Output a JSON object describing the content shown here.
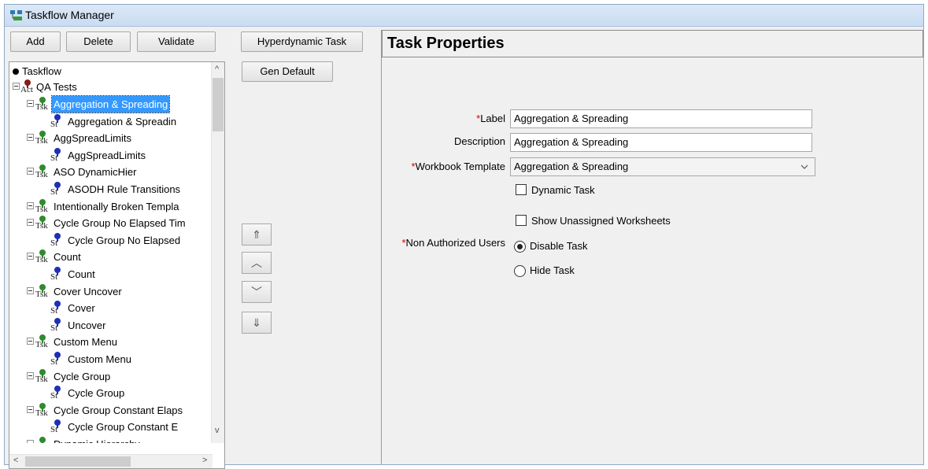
{
  "window": {
    "title": "Taskflow Manager"
  },
  "toolbar": {
    "add_label": "Add",
    "delete_label": "Delete",
    "validate_label": "Validate",
    "hyperdynamic_label": "Hyperdynamic Task",
    "gen_default_label": "Gen Default"
  },
  "tree": {
    "root": "Taskflow",
    "activity": "QA Tests",
    "items": [
      {
        "label": "Aggregation & Spreading",
        "icon": "Tsk"
      },
      {
        "label": "Aggregation & Spreadin",
        "icon": "St"
      },
      {
        "label": "AggSpreadLimits",
        "icon": "Tsk"
      },
      {
        "label": "AggSpreadLimits",
        "icon": "St"
      },
      {
        "label": "ASO DynamicHier",
        "icon": "Tsk"
      },
      {
        "label": "ASODH Rule Transitions",
        "icon": "St"
      },
      {
        "label": "Intentionally Broken Templa",
        "icon": "Tsk"
      },
      {
        "label": "Cycle Group No Elapsed Tim",
        "icon": "Tsk"
      },
      {
        "label": "Cycle Group No Elapsed",
        "icon": "St"
      },
      {
        "label": "Count",
        "icon": "Tsk"
      },
      {
        "label": "Count",
        "icon": "St"
      },
      {
        "label": "Cover Uncover",
        "icon": "Tsk"
      },
      {
        "label": "Cover",
        "icon": "St"
      },
      {
        "label": "Uncover",
        "icon": "St"
      },
      {
        "label": "Custom Menu",
        "icon": "Tsk"
      },
      {
        "label": "Custom Menu",
        "icon": "St"
      },
      {
        "label": "Cycle Group",
        "icon": "Tsk"
      },
      {
        "label": "Cycle Group",
        "icon": "St"
      },
      {
        "label": "Cycle Group Constant Elaps",
        "icon": "Tsk"
      },
      {
        "label": "Cycle Group Constant E",
        "icon": "St"
      },
      {
        "label": "Dynamic Hierarchy",
        "icon": "Tsk"
      }
    ],
    "activity_icon": "Act"
  },
  "move_buttons": {
    "top": "⇑",
    "up": "︿",
    "down": "﹀",
    "bottom": "⇓"
  },
  "properties": {
    "title": "Task Properties",
    "label_label": "Label",
    "label_value": "Aggregation & Spreading",
    "description_label": "Description",
    "description_value": "Aggregation & Spreading",
    "template_label": "Workbook Template",
    "template_value": "Aggregation & Spreading",
    "dynamic_task_label": "Dynamic Task",
    "show_unassigned_label": "Show Unassigned Worksheets",
    "non_auth_label": "Non Authorized Users",
    "disable_task_label": "Disable Task",
    "hide_task_label": "Hide Task",
    "required_mark": "*"
  },
  "colors": {
    "selection": "#3399ff",
    "task_node": "#2e8b2e",
    "step_node": "#1f2fb5",
    "activity_node": "#8b1a1a",
    "required": "#d00000"
  }
}
